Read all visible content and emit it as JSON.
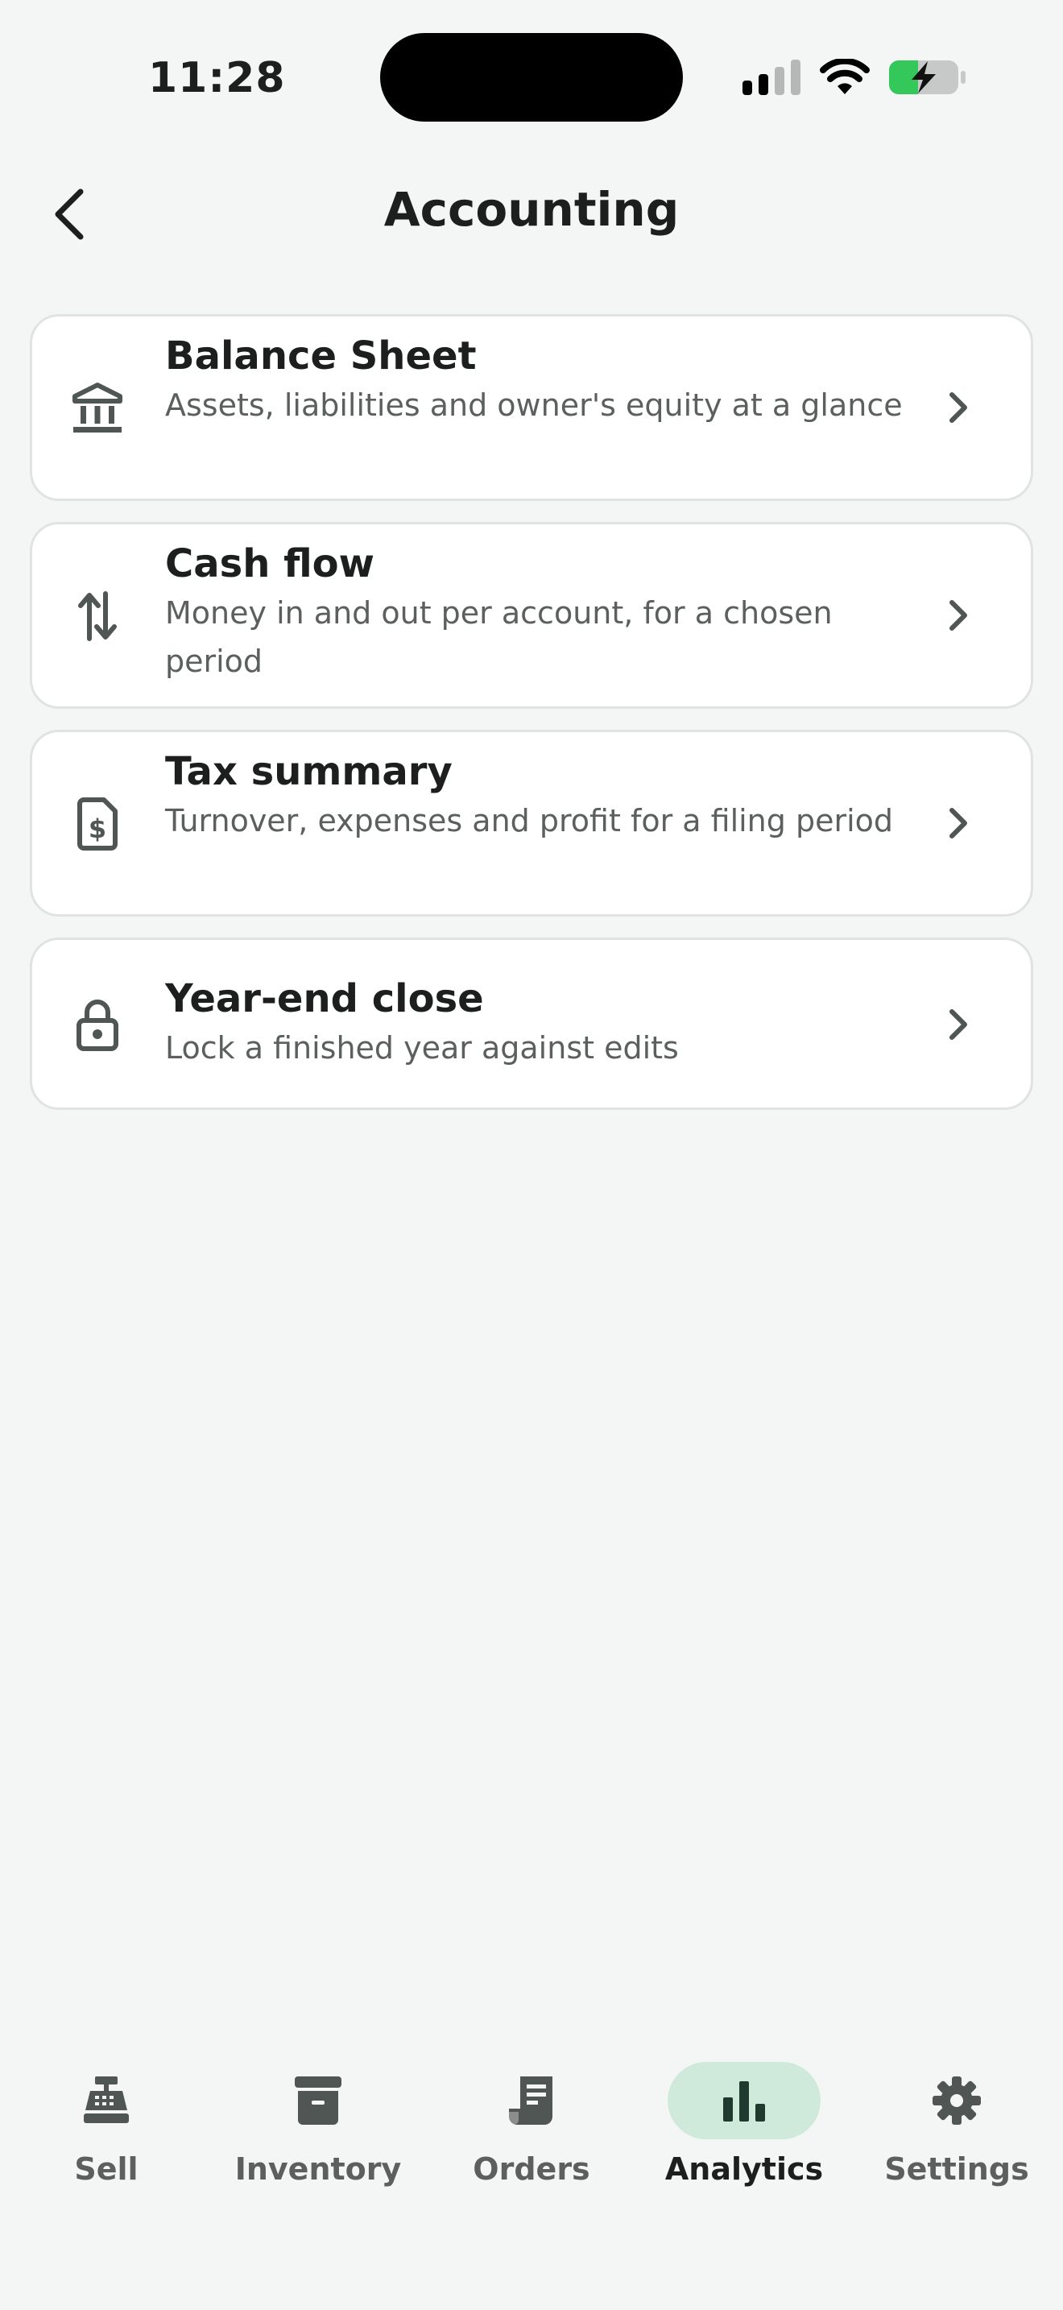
{
  "status_bar": {
    "time": "11:28"
  },
  "header": {
    "title": "Accounting",
    "back_icon": "chevron-left-icon"
  },
  "cards": [
    {
      "icon": "bank-icon",
      "title": "Balance Sheet",
      "description": "Assets, liabilities and owner's equity at a glance"
    },
    {
      "icon": "transfer-arrows-icon",
      "title": "Cash flow",
      "description": "Money in and out per account, for a chosen period"
    },
    {
      "icon": "tax-document-icon",
      "title": "Tax summary",
      "description": "Turnover, expenses and profit for a filing period"
    },
    {
      "icon": "lock-icon",
      "title": "Year-end close",
      "description": "Lock a finished year against edits"
    }
  ],
  "tab_bar": {
    "active": "Analytics",
    "tabs": [
      {
        "label": "Sell",
        "icon": "cash-register-icon"
      },
      {
        "label": "Inventory",
        "icon": "archive-box-icon"
      },
      {
        "label": "Orders",
        "icon": "receipt-icon"
      },
      {
        "label": "Analytics",
        "icon": "bar-chart-icon"
      },
      {
        "label": "Settings",
        "icon": "gear-icon"
      }
    ]
  },
  "colors": {
    "accent_bg": "#cfeadb",
    "background": "#f4f6f5",
    "text_primary": "#1c1f1e",
    "text_secondary": "#5b605e",
    "battery_green": "#34c759"
  }
}
